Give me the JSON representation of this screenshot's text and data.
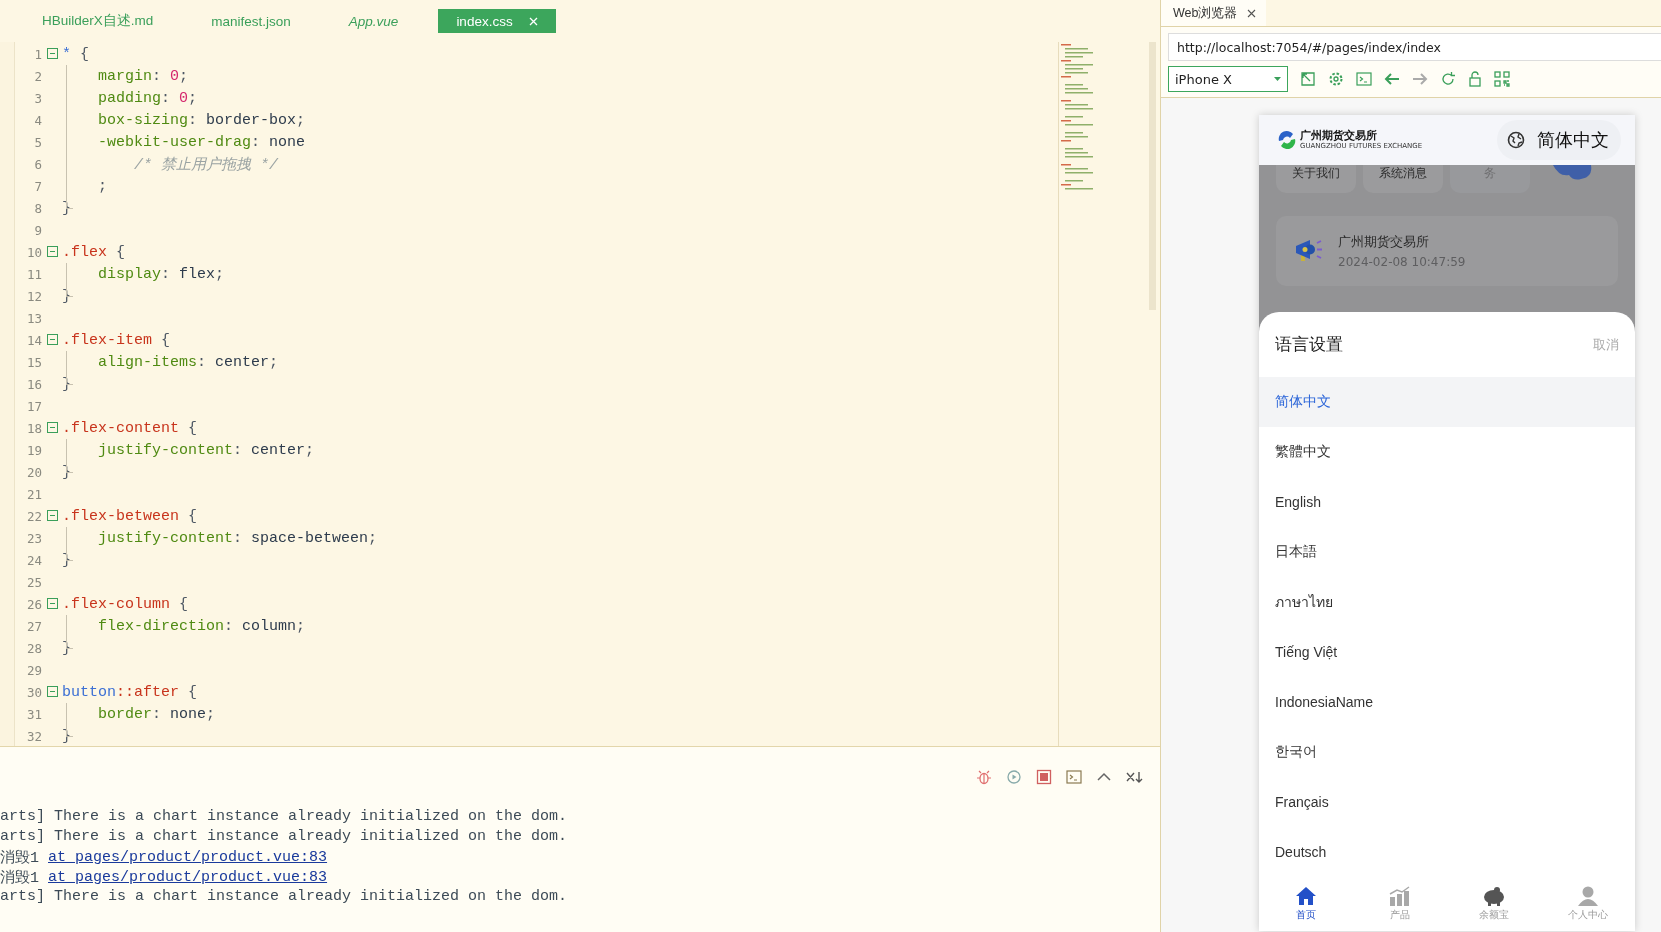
{
  "editor": {
    "tabs": [
      {
        "label": "HBuilderX自述.md",
        "selected": false,
        "preview": false
      },
      {
        "label": "manifest.json",
        "selected": false,
        "preview": false
      },
      {
        "label": "App.vue",
        "selected": false,
        "preview": true
      },
      {
        "label": "index.css",
        "selected": true,
        "preview": false
      }
    ],
    "lines": [
      {
        "number": "1",
        "tokens": [
          {
            "kind": "tag",
            "text": "*"
          },
          {
            "kind": "punct",
            "text": " {"
          }
        ],
        "children": [
          {
            "number": "2",
            "tokens": [
              {
                "kind": "prop",
                "text": "margin"
              },
              {
                "kind": "punct",
                "text": ": "
              },
              {
                "kind": "number",
                "text": "0"
              },
              {
                "kind": "punct",
                "text": ";"
              }
            ]
          },
          {
            "number": "3",
            "tokens": [
              {
                "kind": "prop",
                "text": "padding"
              },
              {
                "kind": "punct",
                "text": ": "
              },
              {
                "kind": "number",
                "text": "0"
              },
              {
                "kind": "punct",
                "text": ";"
              }
            ]
          },
          {
            "number": "4",
            "tokens": [
              {
                "kind": "prop",
                "text": "box-sizing"
              },
              {
                "kind": "punct",
                "text": ": "
              },
              {
                "kind": "value",
                "text": "border-box"
              },
              {
                "kind": "punct",
                "text": ";"
              }
            ]
          },
          {
            "number": "5",
            "tokens": [
              {
                "kind": "prop",
                "text": "-webkit-user-drag"
              },
              {
                "kind": "punct",
                "text": ": "
              },
              {
                "kind": "value",
                "text": "none"
              }
            ]
          },
          {
            "number": "6",
            "tokens": [
              {
                "kind": "comment",
                "text": "    /* 禁止用户拖拽 */"
              }
            ]
          },
          {
            "number": "7",
            "tokens": [
              {
                "kind": "punct",
                "text": ";"
              }
            ]
          }
        ],
        "end": {
          "number": "8",
          "tokens": [
            {
              "kind": "punct",
              "text": "}"
            }
          ]
        }
      },
      {
        "number": "9"
      },
      {
        "number": "10",
        "tokens": [
          {
            "kind": "class",
            "text": ".flex"
          },
          {
            "kind": "punct",
            "text": " {"
          }
        ],
        "children": [
          {
            "number": "11",
            "tokens": [
              {
                "kind": "prop",
                "text": "display"
              },
              {
                "kind": "punct",
                "text": ": "
              },
              {
                "kind": "value",
                "text": "flex"
              },
              {
                "kind": "punct",
                "text": ";"
              }
            ]
          }
        ],
        "end": {
          "number": "12",
          "tokens": [
            {
              "kind": "punct",
              "text": "}"
            }
          ]
        }
      },
      {
        "number": "13"
      },
      {
        "number": "14",
        "tokens": [
          {
            "kind": "class",
            "text": ".flex-item"
          },
          {
            "kind": "punct",
            "text": " {"
          }
        ],
        "children": [
          {
            "number": "15",
            "tokens": [
              {
                "kind": "prop",
                "text": "align-items"
              },
              {
                "kind": "punct",
                "text": ": "
              },
              {
                "kind": "value",
                "text": "center"
              },
              {
                "kind": "punct",
                "text": ";"
              }
            ]
          }
        ],
        "end": {
          "number": "16",
          "tokens": [
            {
              "kind": "punct",
              "text": "}"
            }
          ]
        }
      },
      {
        "number": "17"
      },
      {
        "number": "18",
        "tokens": [
          {
            "kind": "class",
            "text": ".flex-content"
          },
          {
            "kind": "punct",
            "text": " {"
          }
        ],
        "children": [
          {
            "number": "19",
            "tokens": [
              {
                "kind": "prop",
                "text": "justify-content"
              },
              {
                "kind": "punct",
                "text": ": "
              },
              {
                "kind": "value",
                "text": "center"
              },
              {
                "kind": "punct",
                "text": ";"
              }
            ]
          }
        ],
        "end": {
          "number": "20",
          "tokens": [
            {
              "kind": "punct",
              "text": "}"
            }
          ]
        }
      },
      {
        "number": "21"
      },
      {
        "number": "22",
        "tokens": [
          {
            "kind": "class",
            "text": ".flex-between"
          },
          {
            "kind": "punct",
            "text": " {"
          }
        ],
        "children": [
          {
            "number": "23",
            "tokens": [
              {
                "kind": "prop",
                "text": "justify-content"
              },
              {
                "kind": "punct",
                "text": ": "
              },
              {
                "kind": "value",
                "text": "space-between"
              },
              {
                "kind": "punct",
                "text": ";"
              }
            ]
          }
        ],
        "end": {
          "number": "24",
          "tokens": [
            {
              "kind": "punct",
              "text": "}"
            }
          ]
        }
      },
      {
        "number": "25"
      },
      {
        "number": "26",
        "tokens": [
          {
            "kind": "class",
            "text": ".flex-column"
          },
          {
            "kind": "punct",
            "text": " {"
          }
        ],
        "children": [
          {
            "number": "27",
            "tokens": [
              {
                "kind": "prop",
                "text": "flex-direction"
              },
              {
                "kind": "punct",
                "text": ": "
              },
              {
                "kind": "value",
                "text": "column"
              },
              {
                "kind": "punct",
                "text": ";"
              }
            ]
          }
        ],
        "end": {
          "number": "28",
          "tokens": [
            {
              "kind": "punct",
              "text": "}"
            }
          ]
        }
      },
      {
        "number": "29"
      },
      {
        "number": "30",
        "tokens": [
          {
            "kind": "tag",
            "text": "button"
          },
          {
            "kind": "class",
            "text": "::after"
          },
          {
            "kind": "punct",
            "text": " {"
          }
        ],
        "children": [
          {
            "number": "31",
            "tokens": [
              {
                "kind": "prop",
                "text": "border"
              },
              {
                "kind": "punct",
                "text": ": "
              },
              {
                "kind": "value",
                "text": "none"
              },
              {
                "kind": "punct",
                "text": ";"
              }
            ]
          }
        ],
        "end": {
          "number": "32",
          "tokens": [
            {
              "kind": "punct",
              "text": "}"
            }
          ]
        }
      }
    ]
  },
  "console": {
    "logs": [
      {
        "kind": "text",
        "text": "arts] There is a chart instance already initialized on the dom."
      },
      {
        "kind": "text",
        "text": "arts] There is a chart instance already initialized on the dom."
      },
      {
        "kind": "link",
        "text": "消毁1",
        "link": "at pages/product/product.vue:83"
      },
      {
        "kind": "link",
        "text": "消毁1",
        "link": "at pages/product/product.vue:83"
      },
      {
        "kind": "text",
        "text": "arts] There is a chart instance already initialized on the dom."
      }
    ]
  },
  "browser": {
    "tab": {
      "label": "Web浏览器"
    },
    "url": "http://localhost:7054/#/pages/index/index",
    "device": "iPhone X",
    "back_disabled": false,
    "forward_disabled": true
  },
  "phone": {
    "header": {
      "logo_name": "广州期货交易所",
      "logo_subtitle": "GUANGZHOU FUTURES EXCHANGE",
      "language": "简体中文"
    },
    "shortcuts": [
      "关于我们",
      "系统消息",
      "务"
    ],
    "notice": {
      "title": "广州期货交易所",
      "time": "2024-02-08 10:47:59"
    },
    "language_sheet": {
      "title": "语言设置",
      "cancel": "取消",
      "options": [
        {
          "label": "简体中文",
          "selected": true
        },
        {
          "label": "繁體中文",
          "selected": false
        },
        {
          "label": "English",
          "selected": false
        },
        {
          "label": "日本語",
          "selected": false
        },
        {
          "label": "ภาษาไทย",
          "selected": false
        },
        {
          "label": "Tiếng Việt",
          "selected": false
        },
        {
          "label": "IndonesiaName",
          "selected": false
        },
        {
          "label": "한국어",
          "selected": false
        },
        {
          "label": "Français",
          "selected": false
        },
        {
          "label": "Deutsch",
          "selected": false
        }
      ]
    },
    "tab_bar": [
      {
        "label": "首页",
        "kind": "home",
        "selected": true
      },
      {
        "label": "产品",
        "kind": "chart",
        "selected": false
      },
      {
        "label": "余额宝",
        "kind": "piggy",
        "selected": false
      },
      {
        "label": "个人中心",
        "kind": "person",
        "selected": false
      }
    ]
  }
}
